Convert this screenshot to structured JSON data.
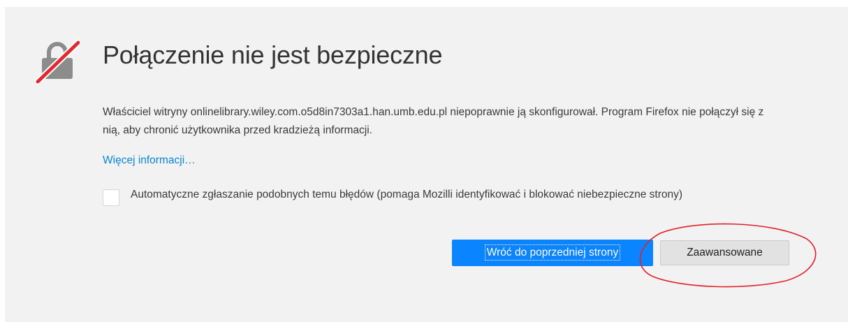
{
  "error_page": {
    "icon": "broken-lock-icon",
    "title": "Połączenie nie jest bezpieczne",
    "description": "Właściciel witryny onlinelibrary.wiley.com.o5d8in7303a1.han.umb.edu.pl niepoprawnie ją skonfigurował. Program Firefox nie połączył się z nią, aby chronić użytkownika przed kradzieżą informacji.",
    "more_info_link": "Więcej informacji…",
    "report_checkbox": {
      "checked": false,
      "label": "Automatyczne zgłaszanie podobnych temu błędów (pomaga Mozilli identyfikować i blokować niebezpieczne strony)"
    },
    "buttons": {
      "go_back": "Wróć do poprzedniej strony",
      "advanced": "Zaawansowane"
    }
  },
  "colors": {
    "panel_background": "#f2f2f2",
    "primary_button": "#0a84ff",
    "link": "#0a84d6",
    "annotation": "#e0202a",
    "lock_gray": "#8c8c8c",
    "slash_red": "#e0282e"
  }
}
